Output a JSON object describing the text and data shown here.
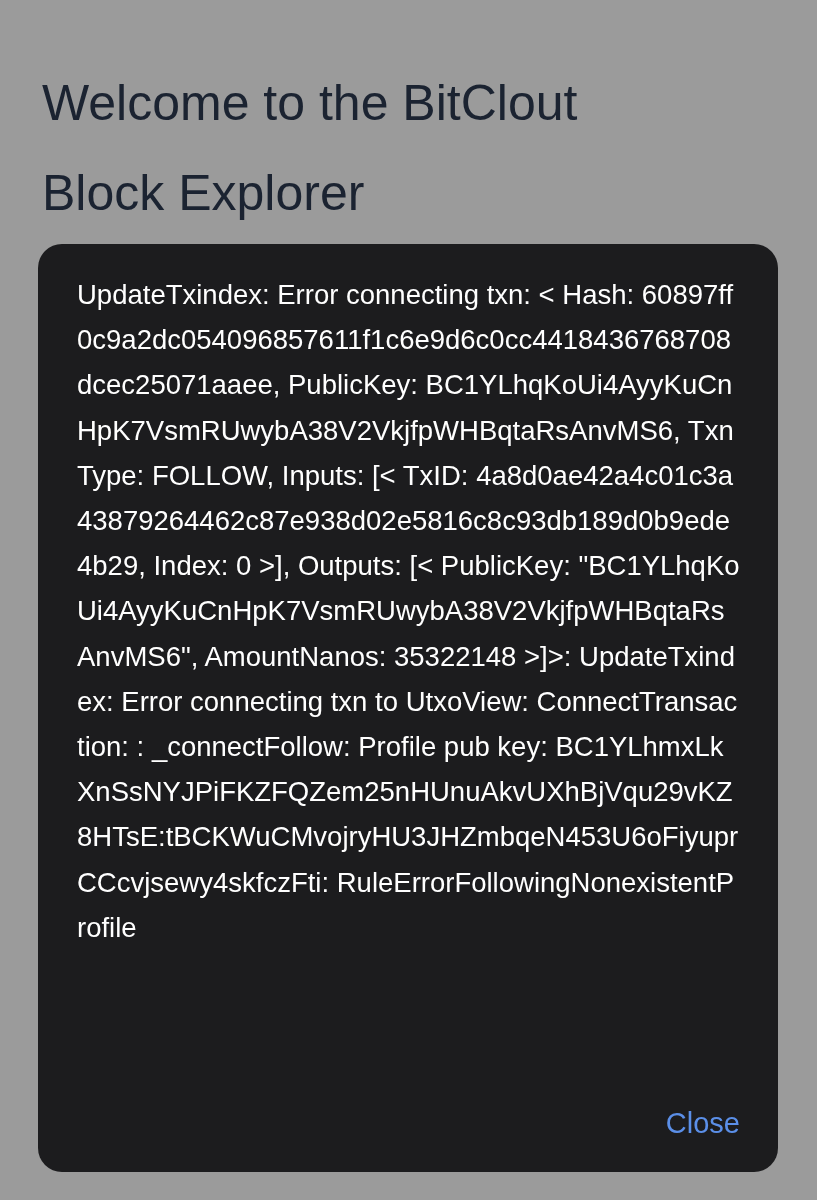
{
  "page": {
    "title": "Welcome to the BitClout Block Explorer"
  },
  "alert": {
    "message": "UpdateTxindex: Error connecting txn: < Hash: 60897ff0c9a2dc054096857611f1c6e9d6c0cc4418436768708dcec25071aaee, PublicKey: BC1YLhqKoUi4AyyKuCnHpK7VsmRUwybA38V2VkjfpWHBqtaRsAnvMS6, TxnType: FOLLOW, Inputs: [< TxID: 4a8d0ae42a4c01c3a43879264462c87e938d02e5816c8c93db189d0b9ede4b29, Index: 0 >], Outputs: [< PublicKey: \"BC1YLhqKoUi4AyyKuCnHpK7VsmRUwybA38V2VkjfpWHBqtaRsAnvMS6\", AmountNanos: 35322148 >]>: UpdateTxindex: Error connecting txn to UtxoView: ConnectTransaction: : _connectFollow: Profile pub key: BC1YLhmxLkXnSsNYJPiFKZFQZem25nHUnuAkvUXhBjVqu29vKZ8HTsE:tBCKWuCMvojryHU3JHZmbqeN453U6oFiyuprCCcvjsewy4skfczFti: RuleErrorFollowingNonexistentProfile",
    "buttons": [
      "Close"
    ]
  }
}
